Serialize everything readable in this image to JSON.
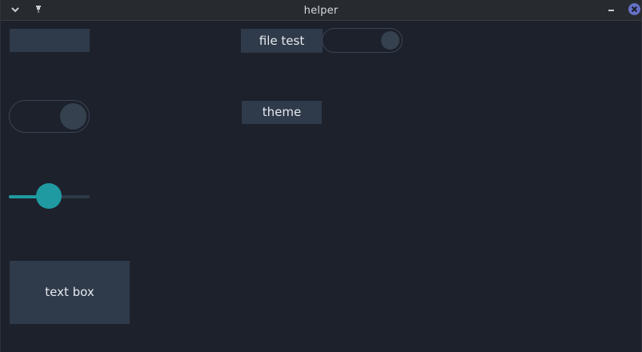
{
  "window": {
    "title": "helper"
  },
  "titlebar": {
    "menu_icon": "chevron-down-icon",
    "pin_icon": "pin-icon",
    "minimize_icon": "minimize-icon",
    "close_icon": "close-icon"
  },
  "widgets": {
    "blank_button": {
      "label": ""
    },
    "file_test_button": {
      "label": "file test"
    },
    "file_test_toggle": {
      "state": "on"
    },
    "left_toggle": {
      "state": "on"
    },
    "theme_button": {
      "label": "theme"
    },
    "slider": {
      "value": 0.5
    },
    "text_box": {
      "label": "text box"
    }
  },
  "colors": {
    "background": "#1d212b",
    "titlebar": "#272a2e",
    "button": "#2f3a4a",
    "accent": "#1f9aa1",
    "close": "#6671c9"
  }
}
